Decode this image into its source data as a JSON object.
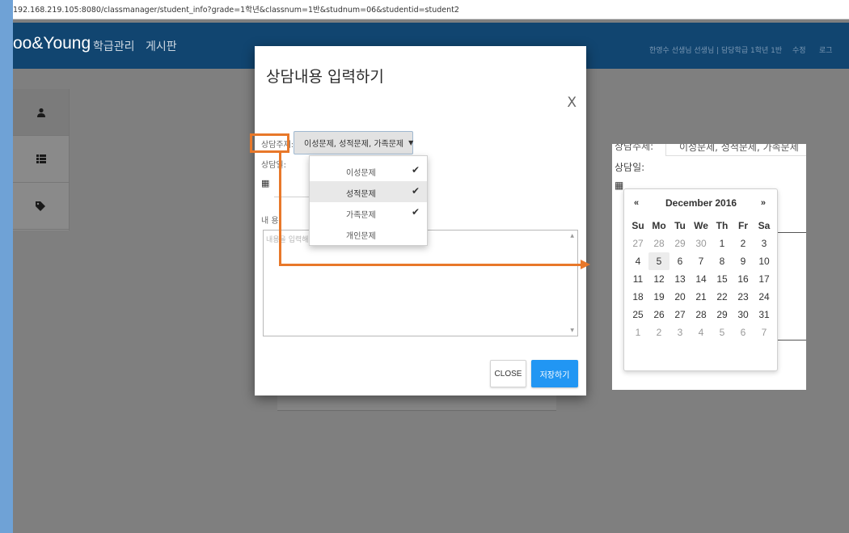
{
  "browser": {
    "url": "192.168.219.105:8080/classmanager/student_info?grade=1학년&classnum=1반&studnum=06&studentid=student2"
  },
  "navbar": {
    "brand": "oo&Young",
    "links": [
      "학급관리",
      "게시판"
    ],
    "user_info": "한영수 선생님 선생님 | 담당학급 1학년 1반",
    "edit": "수정",
    "logout": "로그"
  },
  "sidebar": {
    "icons": [
      "user-icon",
      "list-icon",
      "tags-icon"
    ]
  },
  "modal": {
    "title": "상담내용 입력하기",
    "close_x": "X",
    "topic_label": "상담주제:",
    "topic_value": "이성문제, 성적문제, 가족문제",
    "date_label": "상담일:",
    "content_label": "내 용:",
    "content_placeholder": "내용을 입력해",
    "close_button": "CLOSE",
    "save_button": "저장하기"
  },
  "topic_dropdown": {
    "options": [
      {
        "label": "이성문제",
        "checked": true,
        "highlighted": false
      },
      {
        "label": "성적문제",
        "checked": true,
        "highlighted": true
      },
      {
        "label": "가족문제",
        "checked": true,
        "highlighted": false
      },
      {
        "label": "개인문제",
        "checked": false,
        "highlighted": false
      }
    ]
  },
  "inset": {
    "topic_label": "상담주제:",
    "topic_value": "이성문제, 성적문제, 가족문제",
    "date_label": "상담일:",
    "calendar": {
      "prev": "«",
      "next": "»",
      "title": "December 2016",
      "weekdays": [
        "Su",
        "Mo",
        "Tu",
        "We",
        "Th",
        "Fr",
        "Sa"
      ],
      "weeks": [
        [
          "27",
          "28",
          "29",
          "30",
          "1",
          "2",
          "3"
        ],
        [
          "4",
          "5",
          "6",
          "7",
          "8",
          "9",
          "10"
        ],
        [
          "11",
          "12",
          "13",
          "14",
          "15",
          "16",
          "17"
        ],
        [
          "18",
          "19",
          "20",
          "21",
          "22",
          "23",
          "24"
        ],
        [
          "25",
          "26",
          "27",
          "28",
          "29",
          "30",
          "31"
        ],
        [
          "1",
          "2",
          "3",
          "4",
          "5",
          "6",
          "7"
        ]
      ],
      "today": "5"
    }
  },
  "colors": {
    "navbar": "#114570",
    "accent": "#2196f3",
    "annotation": "#e8782a"
  }
}
